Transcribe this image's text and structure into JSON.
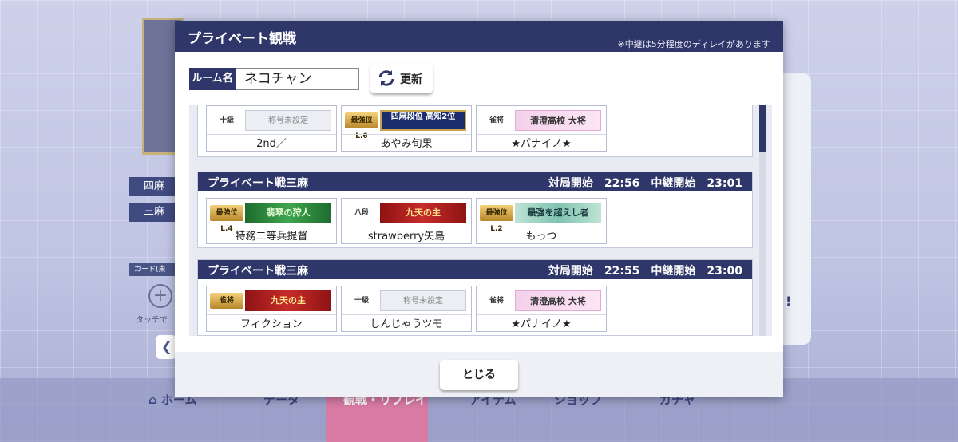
{
  "background": {
    "modes": [
      "四麻",
      "三麻"
    ],
    "card_label": "カード(東",
    "touch_text": "タッチで",
    "nav": [
      "ホーム",
      "データ",
      "観戦・リプレイ",
      "アイテム",
      "ショップ",
      "ガチャ"
    ]
  },
  "modal": {
    "title": "プライベート観戦",
    "note": "※中継は5分程度のディレイがあります",
    "room_label": "ルーム名",
    "room_value": "ネコチャン",
    "refresh_label": "更新",
    "close_label": "とじる"
  },
  "groups": [
    {
      "name": "",
      "time": "",
      "players": [
        {
          "badge": "十級",
          "badge_style": "plain",
          "title": "称号未設定",
          "title_style": "empty",
          "name": "2nd／"
        },
        {
          "badge": "最強位L.6",
          "badge_style": "gold",
          "title": "四麻段位 高知2位",
          "title_style": "blue",
          "name": "あやみ旬果"
        },
        {
          "badge": "雀将",
          "badge_style": "plain",
          "title": "清澄高校 大将",
          "title_style": "pink",
          "name": "★パナイノ★"
        }
      ]
    },
    {
      "name": "プライベート戦三麻",
      "time": "対局開始　22:56　中継開始　23:01",
      "players": [
        {
          "badge": "最強位L.4",
          "badge_style": "gold",
          "title": "翡翠の狩人",
          "title_style": "green",
          "name": "特務二等兵提督"
        },
        {
          "badge": "八段",
          "badge_style": "plain",
          "title": "九天の主",
          "title_style": "red",
          "name": "strawberry矢島"
        },
        {
          "badge": "最強位L.2",
          "badge_style": "gold",
          "title": "最強を超えし者",
          "title_style": "teal",
          "name": "もっつ"
        }
      ]
    },
    {
      "name": "プライベート戦三麻",
      "time": "対局開始　22:55　中継開始　23:00",
      "players": [
        {
          "badge": "雀将",
          "badge_style": "gold",
          "title": "九天の主",
          "title_style": "red",
          "name": "フィクション"
        },
        {
          "badge": "十級",
          "badge_style": "plain",
          "title": "称号未設定",
          "title_style": "empty",
          "name": "しんじゃうツモ"
        },
        {
          "badge": "雀将",
          "badge_style": "plain",
          "title": "清澄高校 大将",
          "title_style": "pink",
          "name": "★パナイノ★"
        }
      ]
    }
  ],
  "colors": {
    "header": "#2f376a",
    "accent_gold": "#c9a34a"
  }
}
